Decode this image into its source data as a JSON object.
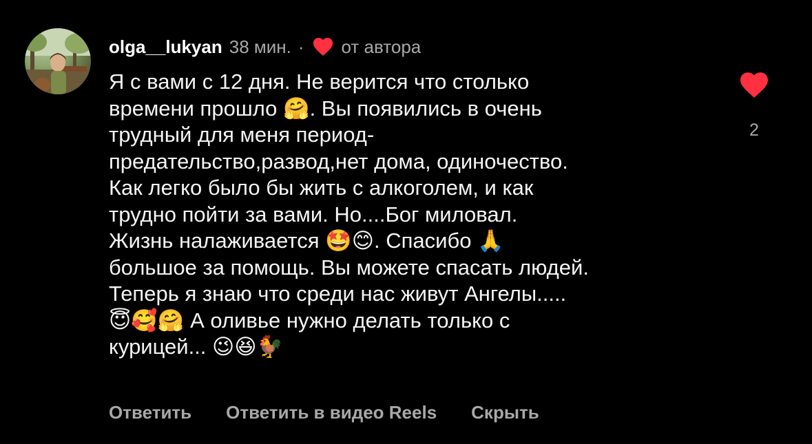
{
  "comment": {
    "username": "olga__lukyan",
    "time": "38 мин.",
    "separator": "·",
    "liked_by_author": "от автора",
    "text": "Я с вами с 12 дня. Не верится что столько\nвремени прошло 🤗. Вы появились в очень\nтрудный для меня период-\nпредательство,развод,нет дома, одиночество.\nКак легко было бы жить с алкоголем, и как\nтрудно пойти за вами. Но....Бог миловал.\nЖизнь налаживается 🤩😊. Спасибо 🙏\nбольшое за помощь. Вы можете спасать людей.\nТеперь я знаю что среди нас живут Ангелы.....\n😇🥰🤗 А оливье нужно делать только с\nкурицей... 😉😆🐓",
    "like_count": "2"
  },
  "actions": {
    "reply": "Ответить",
    "reply_reels": "Ответить в видео Reels",
    "hide": "Скрыть"
  },
  "colors": {
    "background": "#000000",
    "heart": "#ff3040",
    "muted_text": "#a8a8a8"
  },
  "icons": {
    "author_like": "heart-icon",
    "like": "heart-icon"
  }
}
